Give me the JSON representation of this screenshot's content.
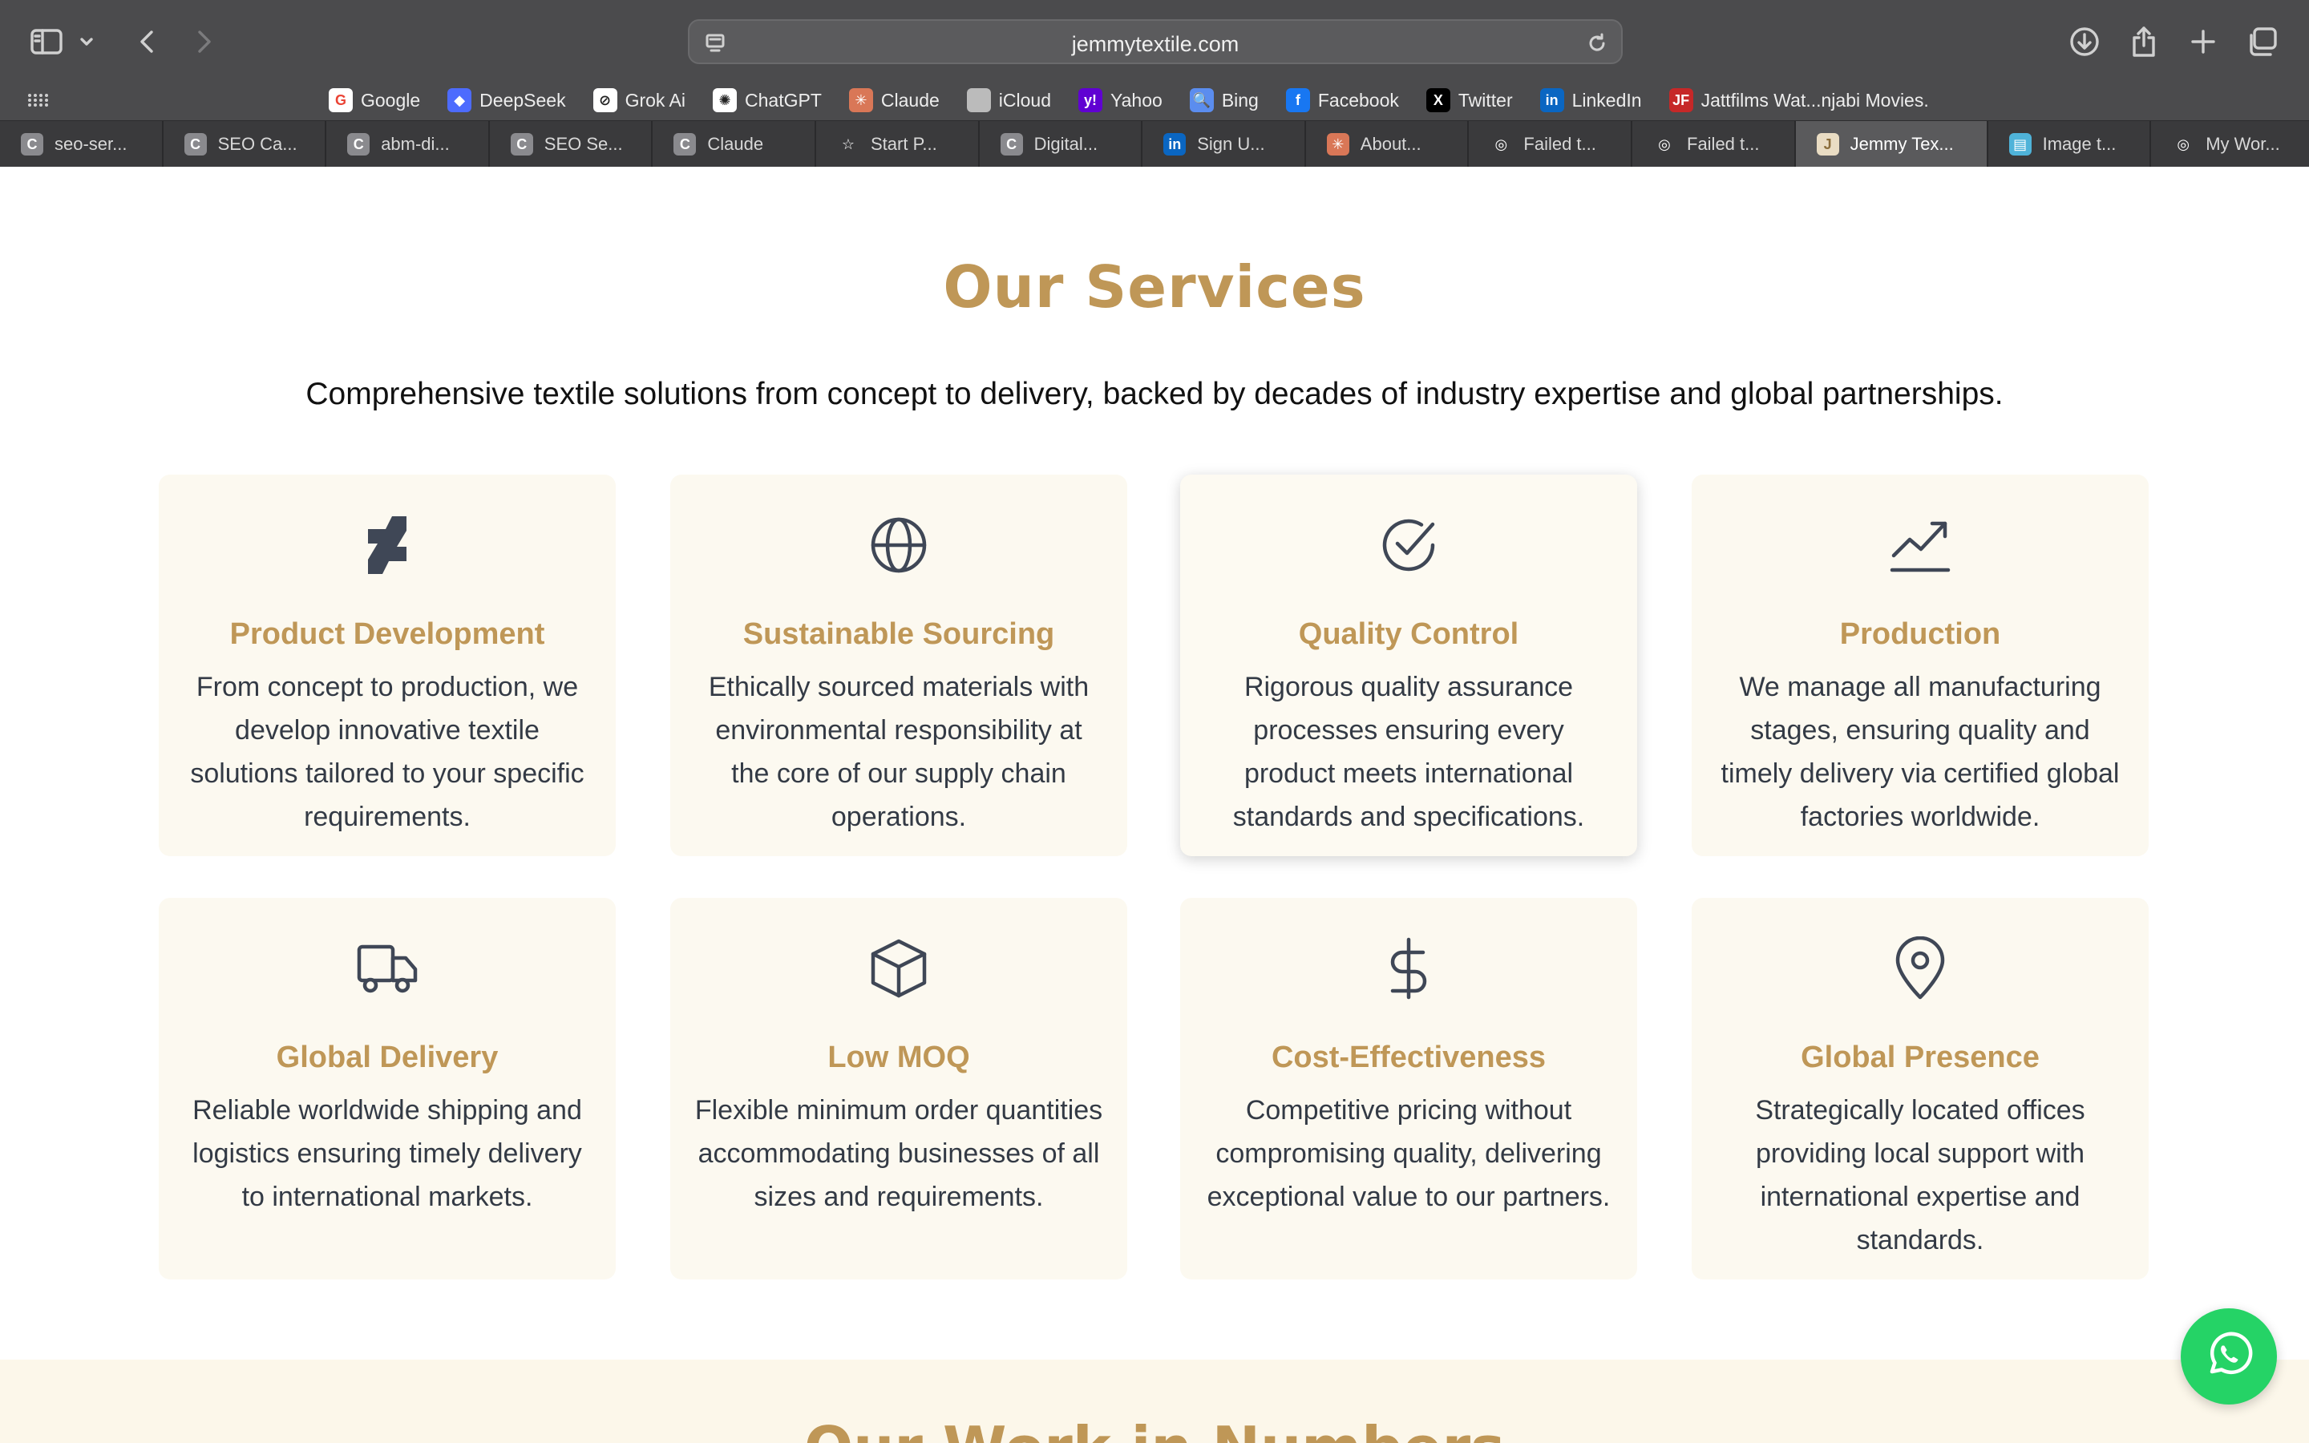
{
  "browser": {
    "url": "jemmytextile.com",
    "favorites": [
      {
        "label": "Google",
        "icon": "google-icon",
        "color": "#ffffff"
      },
      {
        "label": "DeepSeek",
        "icon": "deepseek-icon",
        "color": "#4d6bfe"
      },
      {
        "label": "Grok Ai",
        "icon": "grok-icon",
        "color": "#ffffff"
      },
      {
        "label": "ChatGPT",
        "icon": "chatgpt-icon",
        "color": "#ffffff"
      },
      {
        "label": "Claude",
        "icon": "claude-icon",
        "color": "#d97757"
      },
      {
        "label": "iCloud",
        "icon": "apple-icon",
        "color": "#bbbbbb"
      },
      {
        "label": "Yahoo",
        "icon": "yahoo-icon",
        "color": "#6001d2"
      },
      {
        "label": "Bing",
        "icon": "bing-icon",
        "color": "#5b8def"
      },
      {
        "label": "Facebook",
        "icon": "facebook-icon",
        "color": "#1877f2"
      },
      {
        "label": "Twitter",
        "icon": "x-icon",
        "color": "#000000"
      },
      {
        "label": "LinkedIn",
        "icon": "linkedin-icon",
        "color": "#0a66c2"
      },
      {
        "label": "Jattfilms Wat...njabi Movies.",
        "icon": "jattfilms-icon",
        "color": "#c62828"
      }
    ],
    "tabs": [
      {
        "label": "seo-ser...",
        "icon": "c-icon",
        "active": false
      },
      {
        "label": "SEO Ca...",
        "icon": "c-icon",
        "active": false
      },
      {
        "label": "abm-di...",
        "icon": "c-icon",
        "active": false
      },
      {
        "label": "SEO Se...",
        "icon": "c-icon",
        "active": false
      },
      {
        "label": "Claude",
        "icon": "c-icon",
        "active": false
      },
      {
        "label": "Start P...",
        "icon": "star-icon",
        "active": false
      },
      {
        "label": "Digital...",
        "icon": "c-icon",
        "active": false
      },
      {
        "label": "Sign U...",
        "icon": "linkedin-icon",
        "active": false
      },
      {
        "label": "About...",
        "icon": "claude-icon",
        "active": false
      },
      {
        "label": "Failed t...",
        "icon": "compass-icon",
        "active": false
      },
      {
        "label": "Failed t...",
        "icon": "compass-icon",
        "active": false
      },
      {
        "label": "Jemmy Tex...",
        "icon": "jemmy-icon",
        "active": true
      },
      {
        "label": "Image t...",
        "icon": "document-icon",
        "active": false
      },
      {
        "label": "My Wor...",
        "icon": "compass-icon",
        "active": false
      }
    ]
  },
  "services": {
    "title": "Our Services",
    "subtitle": "Comprehensive textile solutions from concept to delivery, backed by decades of industry expertise and global partnerships.",
    "cards": [
      {
        "title": "Product Development",
        "text": "From concept to production, we develop innovative textile solutions tailored to your specific requirements.",
        "icon": "deviantart-icon"
      },
      {
        "title": "Sustainable Sourcing",
        "text": "Ethically sourced materials with environmental responsibility at the core of our supply chain operations.",
        "icon": "globe-icon"
      },
      {
        "title": "Quality Control",
        "text": "Rigorous quality assurance processes ensuring every product meets international standards and specifications.",
        "icon": "check-circle-icon"
      },
      {
        "title": "Production",
        "text": "We manage all manufacturing stages, ensuring quality and timely delivery via certified global factories worldwide.",
        "icon": "chart-line-icon"
      },
      {
        "title": "Global Delivery",
        "text": "Reliable worldwide shipping and logistics ensuring timely delivery to international markets.",
        "icon": "truck-icon"
      },
      {
        "title": "Low MOQ",
        "text": "Flexible minimum order quantities accommodating businesses of all sizes and requirements.",
        "icon": "box-icon"
      },
      {
        "title": "Cost-Effectiveness",
        "text": "Competitive pricing without compromising quality, delivering exceptional value to our partners.",
        "icon": "dollar-icon"
      },
      {
        "title": "Global Presence",
        "text": "Strategically located offices providing local support with international expertise and standards.",
        "icon": "map-pin-icon"
      }
    ]
  },
  "next_section": {
    "title": "Our Work in Numbers"
  },
  "colors": {
    "accent": "#bf9757",
    "card_bg": "#fcf9f0",
    "icon": "#3f4756",
    "whatsapp": "#25d366"
  }
}
